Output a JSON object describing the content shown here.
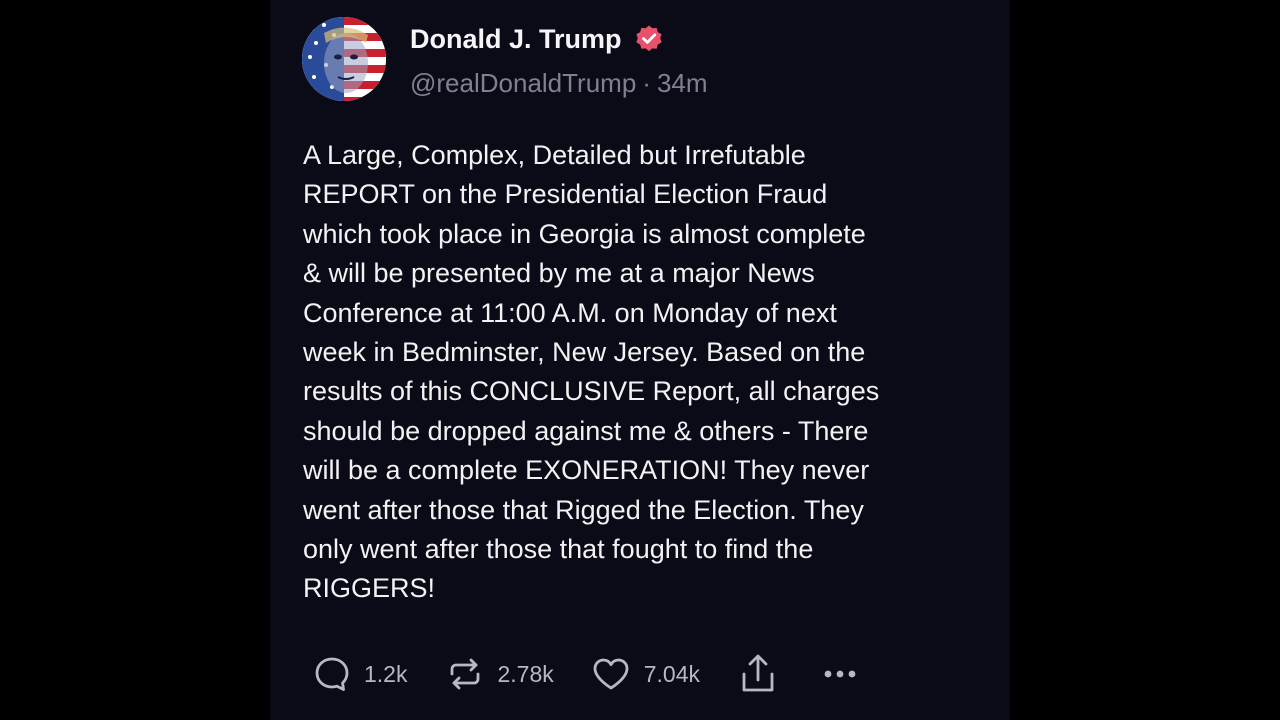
{
  "post": {
    "author": {
      "display_name": "Donald J. Trump",
      "handle": "@realDonaldTrump",
      "separator": "·",
      "timestamp": "34m",
      "verified": true
    },
    "text": "A Large, Complex, Detailed but Irrefutable\nREPORT on the Presidential Election Fraud\nwhich took place in Georgia is almost complete\n& will be presented by me at a major News\nConference at 11:00 A.M. on Monday of next\nweek in Bedminster, New Jersey. Based on the\nresults of this CONCLUSIVE Report, all charges\nshould be dropped against me & others - There\nwill be a complete EXONERATION! They never\nwent after those that Rigged the Election. They\nonly went after those that fought to find the\nRIGGERS!",
    "actions": {
      "reply_count": "1.2k",
      "repost_count": "2.78k",
      "like_count": "7.04k"
    }
  },
  "icons": {
    "reply": "speech-bubble-icon",
    "repost": "repost-arrows-icon",
    "like": "heart-icon",
    "share": "share-upload-icon",
    "more": "more-dots-icon",
    "verified": "verified-badge-icon"
  },
  "colors": {
    "background": "#000000",
    "card": "#0b0b17",
    "verified_badge": "#e8506b",
    "meta_text": "#80808f"
  }
}
